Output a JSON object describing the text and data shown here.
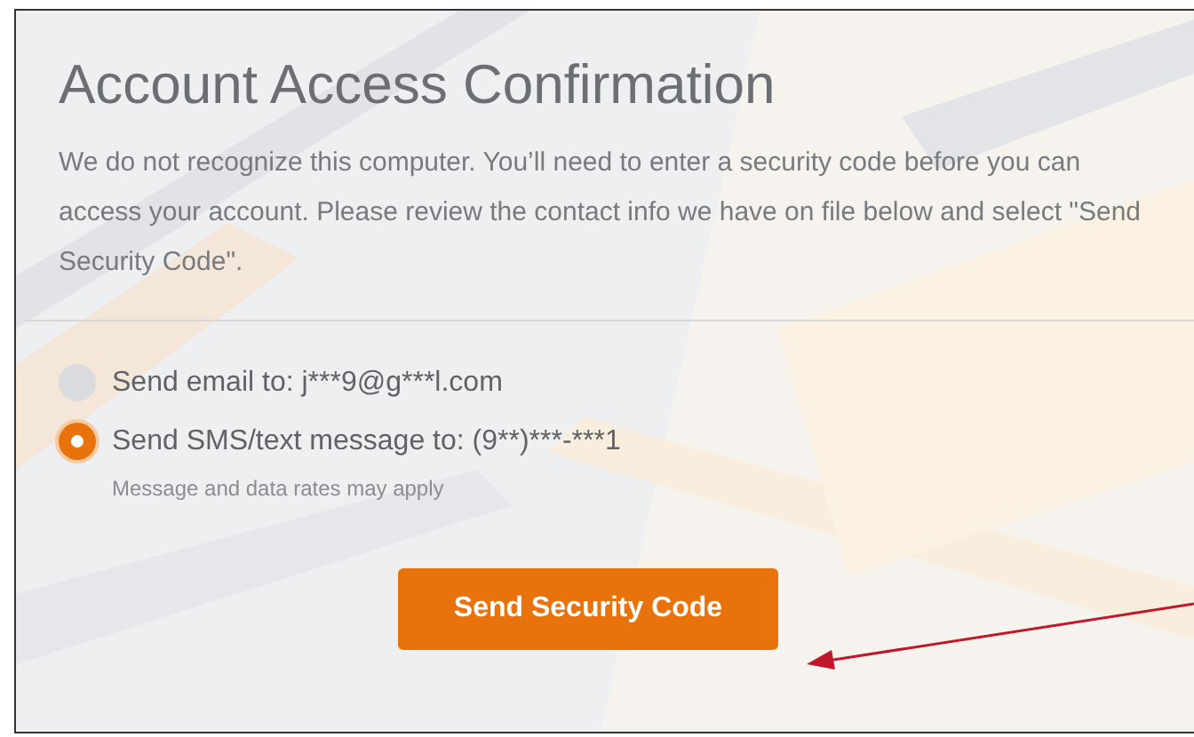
{
  "title": "Account Access Confirmation",
  "intro": "We do not recognize this computer. You’ll need to enter a security code before you can access your account. Please review the contact info we have on file below and select \"Send Security Code\".",
  "options": [
    {
      "label": "Send email to: j***9@g***l.com",
      "selected": false
    },
    {
      "label": "Send SMS/text message to: (9**)***-***1",
      "selected": true,
      "note": "Message and data rates may apply"
    }
  ],
  "button": "Send Security Code"
}
